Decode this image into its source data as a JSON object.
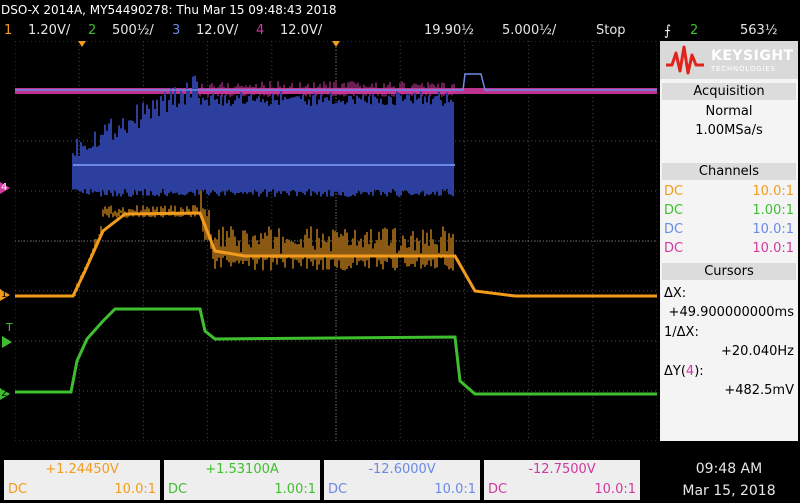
{
  "header": {
    "title": "DSO-X 2014A, MY54490278: Thu Mar 15 09:48:43 2018"
  },
  "status": {
    "ch1_num": "1",
    "ch1_scale": "1.20V/",
    "ch2_num": "2",
    "ch2_scale": "500½/",
    "ch3_num": "3",
    "ch3_scale": "12.0V/",
    "ch4_num": "4",
    "ch4_scale": "12.0V/",
    "delay": "19.90½",
    "timebase": "5.000½/",
    "run_state": "Stop",
    "trigger_icon": "trigger-falling-edge-icon",
    "trigger_source": "2",
    "trigger_level": "563½"
  },
  "screen": {
    "marker_4": "4",
    "marker_1": "1",
    "marker_t": "T",
    "marker_2": "2"
  },
  "panel": {
    "brand": "KEYSIGHT",
    "brand_sub": "TECHNOLOGIES",
    "acquisition": {
      "header": "Acquisition",
      "mode": "Normal",
      "rate": "1.00MSa/s"
    },
    "channels": {
      "header": "Channels",
      "rows": [
        {
          "coupling": "DC",
          "probe": "10.0:1",
          "color": "#f39c1c"
        },
        {
          "coupling": "DC",
          "probe": "1.00:1",
          "color": "#3fbf2f"
        },
        {
          "coupling": "DC",
          "probe": "10.0:1",
          "color": "#6b8ae6"
        },
        {
          "coupling": "DC",
          "probe": "10.0:1",
          "color": "#d23aa0"
        }
      ]
    },
    "cursors": {
      "header": "Cursors",
      "dx_label": "ΔX:",
      "dx_value": "+49.900000000ms",
      "inv_label": "1/ΔX:",
      "inv_value": "+20.040Hz",
      "dy_label": "ΔY(",
      "dy_ch": "4",
      "dy_close": "):",
      "dy_value": "+482.5mV"
    }
  },
  "bottom": {
    "cells": [
      {
        "value": "+1.24450V",
        "coupling": "DC",
        "probe": "10.0:1",
        "color": "#f39c1c"
      },
      {
        "value": "+1.53100A",
        "coupling": "DC",
        "probe": "1.00:1",
        "color": "#3fbf2f"
      },
      {
        "value": "-12.6000V",
        "coupling": "DC",
        "probe": "10.0:1",
        "color": "#6b8ae6"
      },
      {
        "value": "-12.7500V",
        "coupling": "DC",
        "probe": "10.0:1",
        "color": "#d23aa0"
      }
    ],
    "time": "09:48 AM",
    "date": "Mar 15, 2018"
  },
  "colors": {
    "ch1": "#f39c1c",
    "ch2": "#3fbf2f",
    "ch3": "#6b8ae6",
    "ch4": "#d23aa0"
  }
}
